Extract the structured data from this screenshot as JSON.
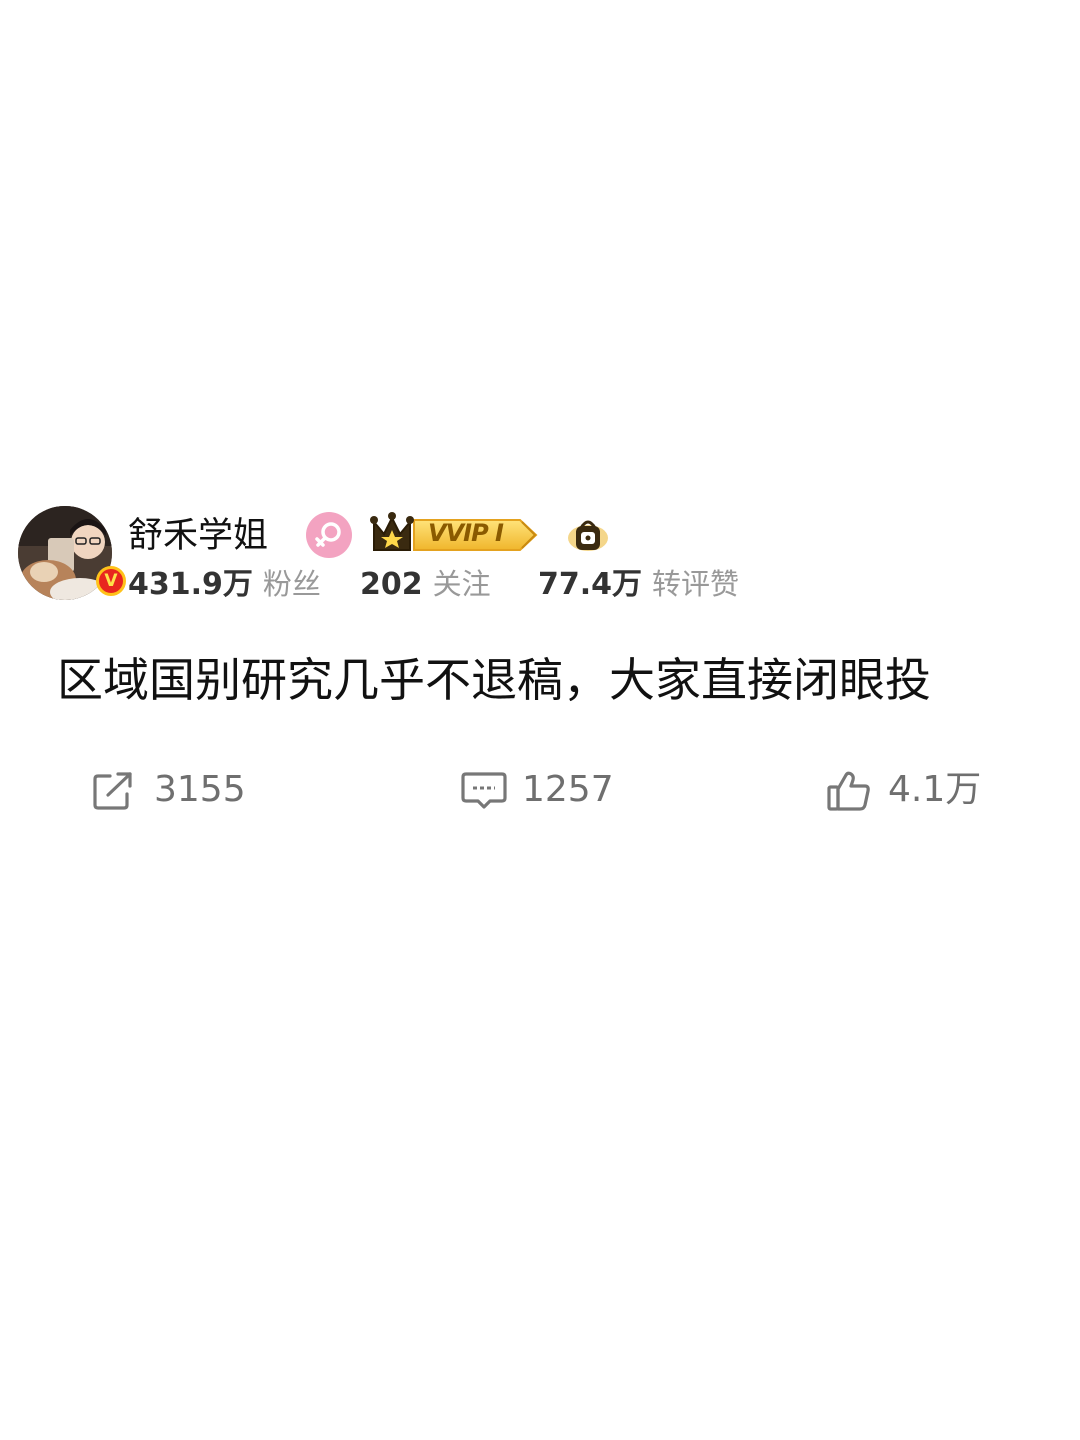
{
  "user": {
    "name": "舒禾学姐",
    "badges": {
      "gender_icon": "female-icon",
      "vip_label": "VVIP I",
      "extra_icon": "lock-icon"
    },
    "stats": {
      "followers_value": "431.9万",
      "followers_label": "粉丝",
      "following_value": "202",
      "following_label": "关注",
      "engagement_value": "77.4万",
      "engagement_label": "转评赞"
    }
  },
  "post": {
    "text": "区域国别研究几乎不退稿，大家直接闭眼投"
  },
  "actions": {
    "repost_count": "3155",
    "comment_count": "1257",
    "like_count": "4.1万"
  },
  "colors": {
    "verified_red": "#e8261f",
    "vip_gold": "#f7c63a",
    "gender_pink": "#f3a3c1",
    "muted_text": "#999999"
  }
}
